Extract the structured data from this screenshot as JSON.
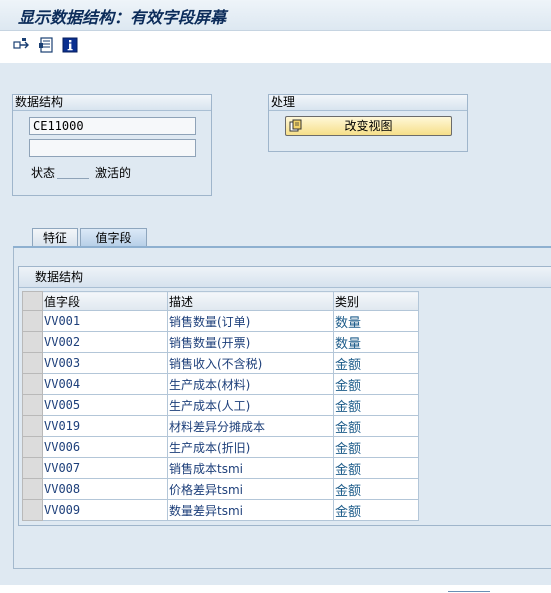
{
  "window": {
    "title": "显示数据结构：有效字段屏幕"
  },
  "toolbar": {
    "buttons": [
      {
        "icon": "other-object-icon"
      },
      {
        "icon": "display-document-icon"
      },
      {
        "icon": "info-icon"
      }
    ]
  },
  "data_structure": {
    "header": "数据结构",
    "name_value": "CE11000",
    "description_value": "",
    "status_label": "状态",
    "status_value": "激活的"
  },
  "processing": {
    "header": "处理",
    "change_view_label": "改变视图"
  },
  "tabs": [
    {
      "label": "特征",
      "active": false
    },
    {
      "label": "值字段",
      "active": true
    }
  ],
  "table": {
    "title": "数据结构",
    "columns": [
      "值字段",
      "描述",
      "类别"
    ],
    "rows": [
      [
        "VV001",
        "销售数量(订单)",
        "数量"
      ],
      [
        "VV002",
        "销售数量(开票)",
        "数量"
      ],
      [
        "VV003",
        "销售收入(不含税)",
        "金额"
      ],
      [
        "VV004",
        "生产成本(材料)",
        "金额"
      ],
      [
        "VV005",
        "生产成本(人工)",
        "金额"
      ],
      [
        "VV019",
        "材料差异分摊成本",
        "金额"
      ],
      [
        "VV006",
        "生产成本(折旧)",
        "金额"
      ],
      [
        "VV007",
        "销售成本tsmi",
        "金额"
      ],
      [
        "VV008",
        "价格差异tsmi",
        "金额"
      ],
      [
        "VV009",
        "数量差异tsmi",
        "金额"
      ]
    ]
  },
  "colors": {
    "title_text": "#0c2c5a",
    "background": "#dfe9f2",
    "link_text": "#1d3f7a"
  }
}
